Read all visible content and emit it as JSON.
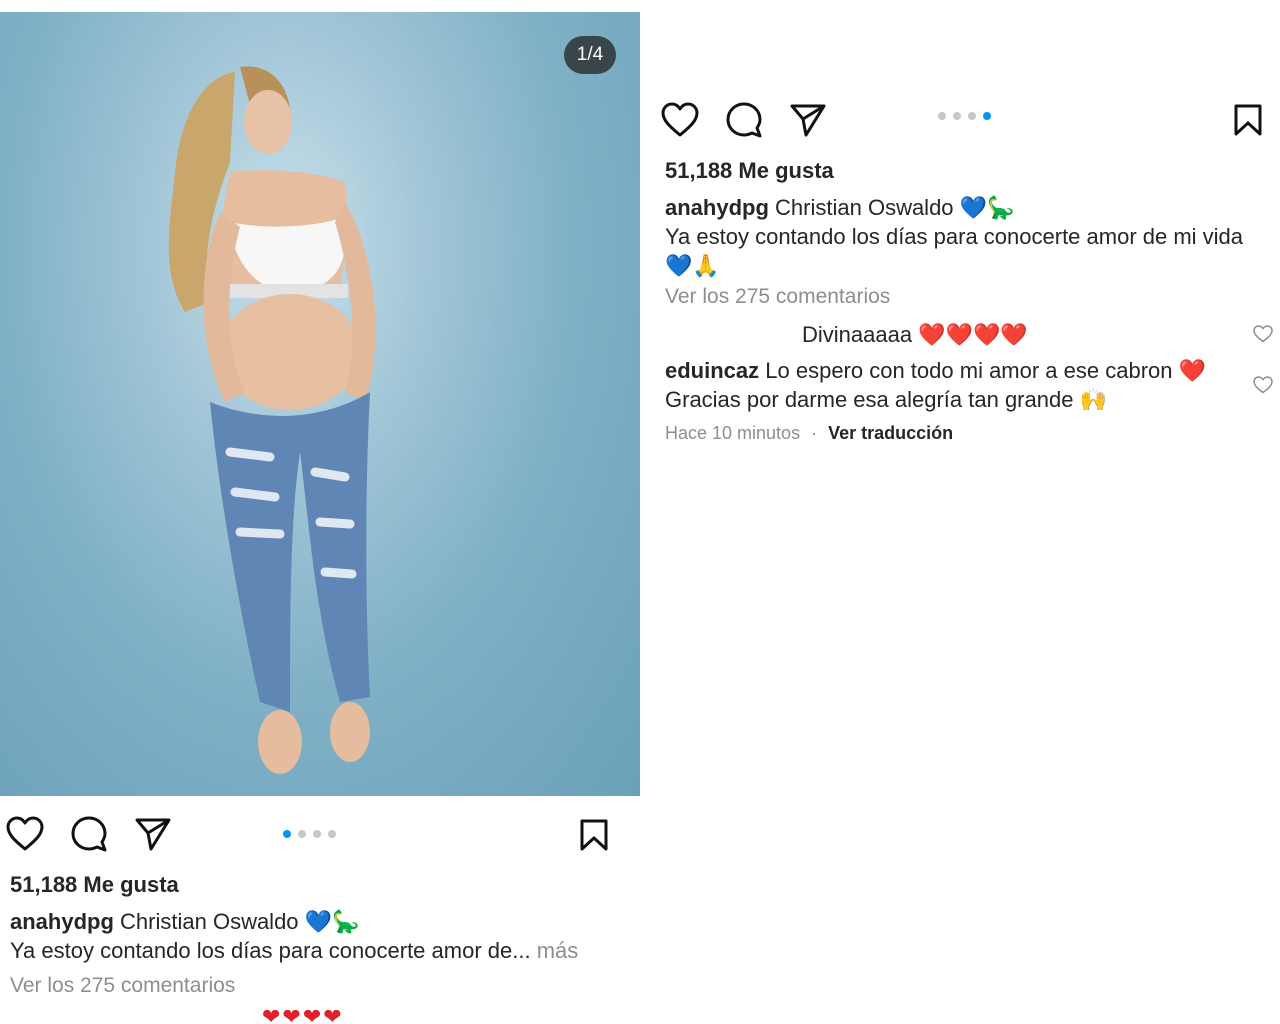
{
  "image_counter": "1/4",
  "carousel": {
    "count": 4,
    "active_left": 0,
    "active_right": 3
  },
  "post": {
    "likes": "51,188 Me gusta",
    "username": "anahydpg",
    "caption_title": "Christian Oswaldo 💙🦕",
    "caption_body_truncated": "Ya estoy contando los días para conocerte amor de...",
    "more_label": "más",
    "caption_body_full": "Ya estoy contando los días para conocerte amor de mi vida",
    "caption_emojis": "💙🙏",
    "view_comments": "Ver los 275 comentarios"
  },
  "comments": [
    {
      "username": "",
      "text": "Divinaaaaa ❤️❤️❤️❤️"
    },
    {
      "username": "eduincaz",
      "text": "Lo espero con todo mi amor a ese cabron ❤️",
      "text2": "Gracias por darme esa alegría tan grande 🙌"
    }
  ],
  "comment_meta": {
    "time": "Hace 10 minutos",
    "separator": "·",
    "translate": "Ver traducción"
  },
  "colors": {
    "accent": "#0095f6",
    "secondary_text": "#8e8e8e",
    "text": "#262626"
  }
}
